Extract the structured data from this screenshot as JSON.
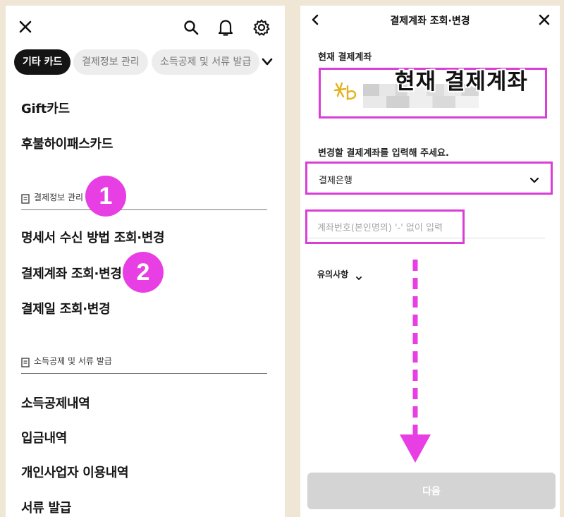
{
  "left": {
    "chips": [
      "기타 카드",
      "결제정보 관리",
      "소득공제 및 서류 발급"
    ],
    "menu_top": [
      "Gift카드",
      "후불하이패스카드"
    ],
    "section1": {
      "header": "결제정보 관리",
      "items": [
        "명세서 수신 방법 조회·변경",
        "결제계좌 조회·변경",
        "결제일 조회·변경"
      ]
    },
    "section2": {
      "header": "소득공제 및 서류 발급",
      "items": [
        "소득공제내역",
        "입금내역",
        "개인사업자 이용내역",
        "서류 발급"
      ]
    },
    "badges": [
      "1",
      "2"
    ],
    "icons": [
      "close-icon",
      "search-icon",
      "bell-icon",
      "gear-icon",
      "chevron-down-icon",
      "document-icon"
    ]
  },
  "right": {
    "title": "결제계좌 조회·변경",
    "current_label": "현재 결제계좌",
    "annotation": "현재 결제계좌",
    "instruction": "변경할 결제계좌를 입력해 주세요.",
    "bank_select": "결제은행",
    "account_placeholder": "계좌번호(본인명의) '-' 없이 입력",
    "notice": "유의사항",
    "next_button": "다음",
    "icons": [
      "back-icon",
      "close-icon",
      "kb-logo-icon",
      "chevron-down-icon",
      "down-arrow-icon"
    ]
  },
  "colors": {
    "annotation_magenta": "#e83fe4",
    "background": "#efe6d6",
    "chip_active": "#141414",
    "button_disabled": "#d4d4d4"
  }
}
